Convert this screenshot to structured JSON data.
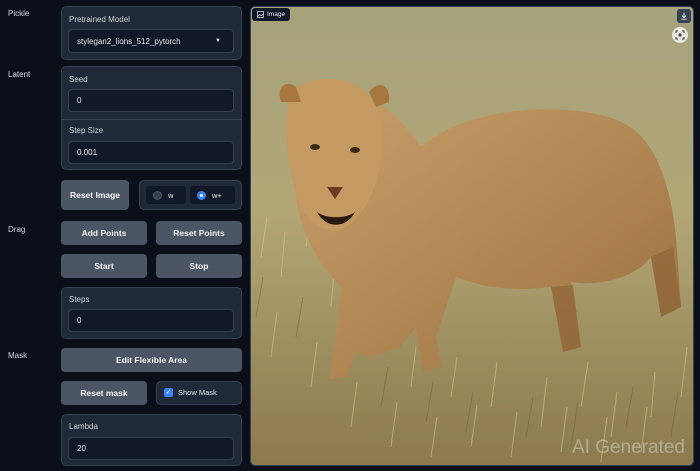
{
  "sections": {
    "pickle": "Pickle",
    "latent": "Latent",
    "drag": "Drag",
    "mask": "Mask"
  },
  "pretrained_model": {
    "label": "Pretrained Model",
    "value": "stylegan2_lions_512_pytorch"
  },
  "seed": {
    "label": "Seed",
    "value": "0"
  },
  "step_size": {
    "label": "Step Size",
    "value": "0.001"
  },
  "reset_image_label": "Reset Image",
  "latent_space": {
    "options": [
      "w",
      "w+"
    ],
    "selected": "w+"
  },
  "drag_buttons": {
    "add_points": "Add Points",
    "reset_points": "Reset Points",
    "start": "Start",
    "stop": "Stop"
  },
  "steps": {
    "label": "Steps",
    "value": "0"
  },
  "mask": {
    "edit_flexible_area": "Edit Flexible Area",
    "reset_mask": "Reset mask",
    "show_mask_label": "Show Mask",
    "show_mask_checked": true
  },
  "lambda": {
    "label": "Lambda",
    "value": "20"
  },
  "image_panel": {
    "tag_label": "Image",
    "watermark": "AI Generated"
  },
  "colors": {
    "background": "#0b0f19",
    "panel": "#1f2937",
    "button": "#4b5563",
    "accent": "#3b82f6"
  }
}
